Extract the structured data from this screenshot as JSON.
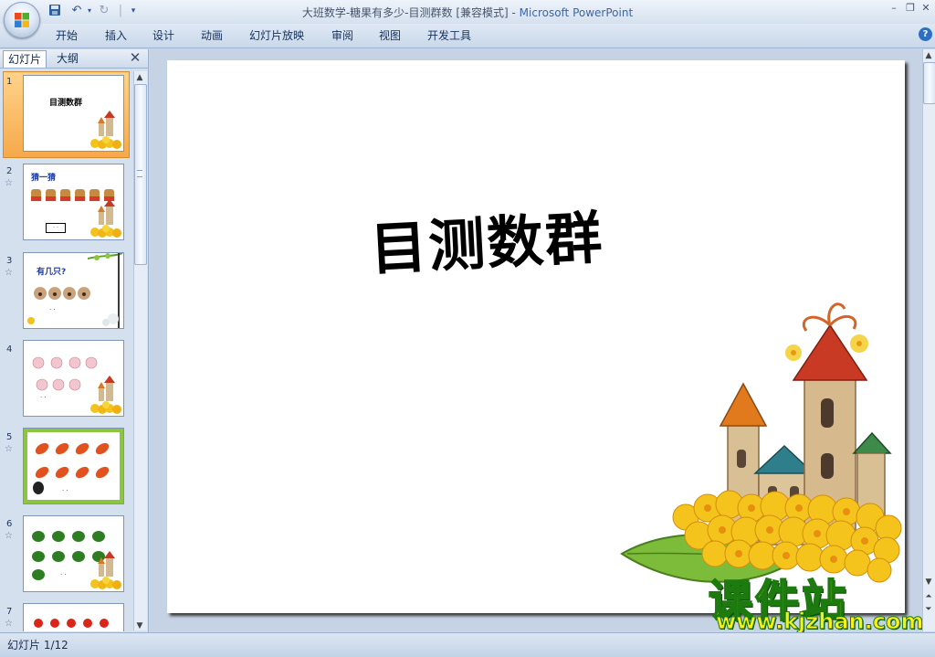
{
  "window": {
    "title_doc": "大班数学-糖果有多少-目测群数 [兼容模式] - ",
    "title_app": "Microsoft PowerPoint"
  },
  "ribbon": {
    "tabs": [
      "开始",
      "插入",
      "设计",
      "动画",
      "幻灯片放映",
      "审阅",
      "视图",
      "开发工具"
    ]
  },
  "pane": {
    "tab_slides": "幻灯片",
    "tab_outline": "大纲",
    "thumbnails": [
      {
        "num": "1",
        "text": "目测数群"
      },
      {
        "num": "2",
        "text": "猜一猜"
      },
      {
        "num": "3",
        "text": "有几只?"
      },
      {
        "num": "4",
        "text": ""
      },
      {
        "num": "5",
        "text": ""
      },
      {
        "num": "6",
        "text": ""
      },
      {
        "num": "7",
        "text": ""
      }
    ],
    "dots": "· ·"
  },
  "slide": {
    "title": "目测数群"
  },
  "status": {
    "text": "幻灯片 1/12"
  },
  "watermark": {
    "main": "课件站",
    "url": "www.kjzhan.com"
  }
}
